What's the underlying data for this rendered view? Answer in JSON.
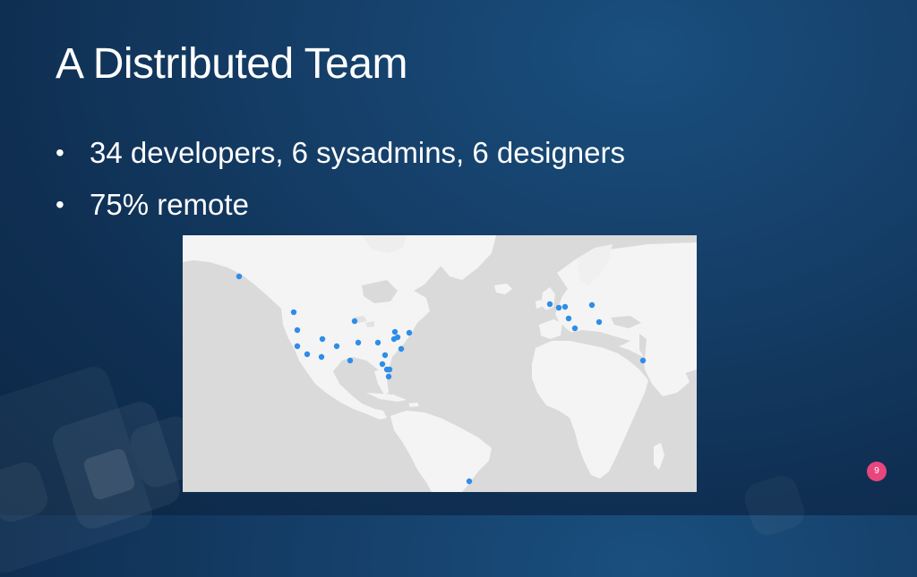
{
  "slide": {
    "title": "A Distributed Team",
    "bullets": [
      "34 developers, 6 sysadmins, 6 designers",
      "75% remote"
    ],
    "page_number": "9"
  },
  "map": {
    "land_color": "#f4f4f4",
    "ocean_color": "#dadada",
    "marker_color": "#2e8de6",
    "marker_count": 31
  },
  "colors": {
    "background": "#133e66",
    "page_badge": "#e8467c"
  }
}
